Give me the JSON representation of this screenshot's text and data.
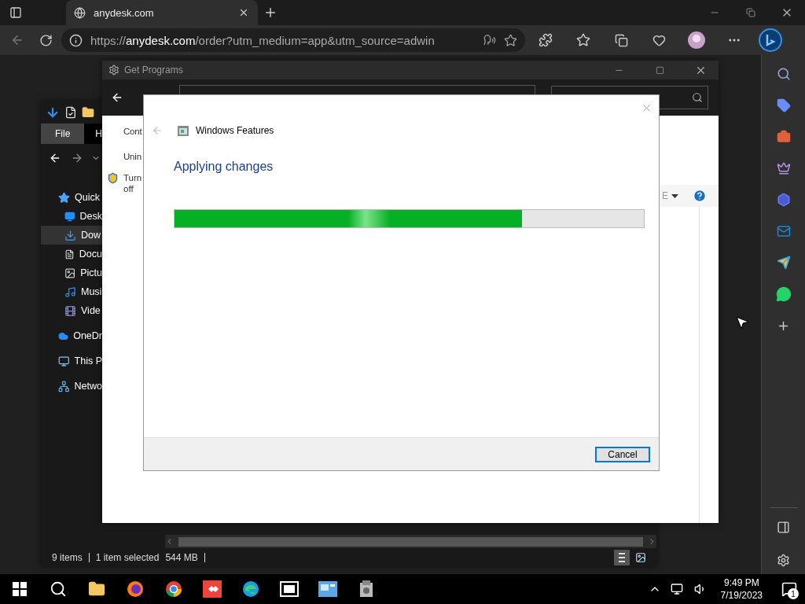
{
  "browser": {
    "tab": {
      "title": "anydesk.com"
    },
    "address": {
      "scheme": "https://",
      "domain": "anydesk.com",
      "path": "/order?utm_medium=app&utm_source=adwin"
    }
  },
  "explorer": {
    "ribbon_tabs": [
      {
        "label": "File",
        "selected": true
      },
      {
        "label": "H",
        "selected": false
      }
    ],
    "nav_items": [
      {
        "label": "Quick",
        "kind": "star",
        "selected": false,
        "indent": false
      },
      {
        "label": "Desk",
        "kind": "desktop",
        "selected": false,
        "indent": true
      },
      {
        "label": "Dow",
        "kind": "download",
        "selected": true,
        "indent": true
      },
      {
        "label": "Docu",
        "kind": "document",
        "selected": false,
        "indent": true
      },
      {
        "label": "Pictu",
        "kind": "picture",
        "selected": false,
        "indent": true
      },
      {
        "label": "Musi",
        "kind": "music",
        "selected": false,
        "indent": true
      },
      {
        "label": "Vide",
        "kind": "video",
        "selected": false,
        "indent": true
      },
      {
        "label": "OneDr",
        "kind": "cloud",
        "selected": false,
        "indent": false
      },
      {
        "label": "This P",
        "kind": "pc",
        "selected": false,
        "indent": false
      },
      {
        "label": "Netwo",
        "kind": "network",
        "selected": false,
        "indent": false
      }
    ],
    "status": {
      "count": "9 items",
      "selection": "1 item selected",
      "size": "544 MB"
    }
  },
  "get_programs": {
    "title": "Get Programs",
    "links": [
      "Cont",
      "Unin"
    ],
    "task": "Turn off",
    "view_label": "E"
  },
  "dialog": {
    "title": "Windows Features",
    "heading": "Applying changes",
    "progress": {
      "level": 0.74
    },
    "cancel": "Cancel"
  },
  "taskbar": {
    "time": "9:49 PM",
    "date": "7/19/2023",
    "notifications": "1"
  }
}
